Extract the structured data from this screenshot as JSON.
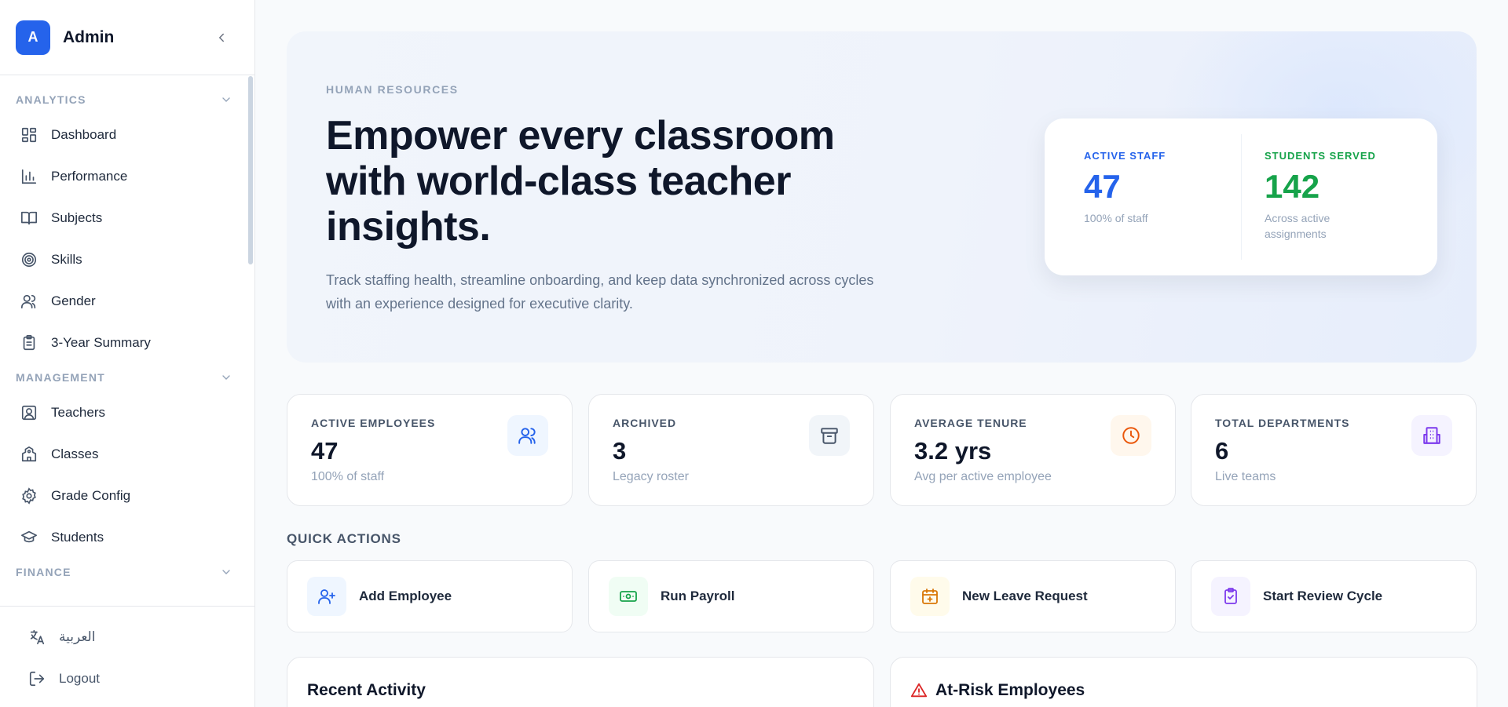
{
  "sidebar": {
    "avatar_letter": "A",
    "brand": "Admin",
    "sections": [
      {
        "label": "ANALYTICS",
        "items": [
          {
            "label": "Dashboard",
            "icon": "dashboard-icon"
          },
          {
            "label": "Performance",
            "icon": "bar-chart-icon"
          },
          {
            "label": "Subjects",
            "icon": "book-icon"
          },
          {
            "label": "Skills",
            "icon": "target-icon"
          },
          {
            "label": "Gender",
            "icon": "users-icon"
          },
          {
            "label": "3-Year Summary",
            "icon": "clipboard-icon"
          }
        ]
      },
      {
        "label": "MANAGEMENT",
        "items": [
          {
            "label": "Teachers",
            "icon": "contact-icon"
          },
          {
            "label": "Classes",
            "icon": "school-icon"
          },
          {
            "label": "Grade Config",
            "icon": "gear-icon"
          },
          {
            "label": "Students",
            "icon": "graduation-cap-icon"
          }
        ]
      },
      {
        "label": "FINANCE",
        "items": []
      }
    ],
    "footer": {
      "language": "العربية",
      "logout": "Logout"
    }
  },
  "hero": {
    "eyebrow": "HUMAN RESOURCES",
    "title": "Empower every classroom with world-class teacher insights.",
    "description": "Track staffing health, streamline onboarding, and keep data synchronized across cycles with an experience designed for executive clarity.",
    "card": {
      "active_staff_label": "ACTIVE STAFF",
      "active_staff_value": "47",
      "active_staff_sub": "100% of staff",
      "students_label": "STUDENTS SERVED",
      "students_value": "142",
      "students_sub": "Across active assignments"
    }
  },
  "stats": [
    {
      "label": "ACTIVE EMPLOYEES",
      "value": "47",
      "sub": "100% of staff",
      "icon": "users-icon",
      "color": "#2563eb",
      "bg": "#eff6ff"
    },
    {
      "label": "ARCHIVED",
      "value": "3",
      "sub": "Legacy roster",
      "icon": "archive-icon",
      "color": "#475569",
      "bg": "#f1f5f9"
    },
    {
      "label": "AVERAGE TENURE",
      "value": "3.2 yrs",
      "sub": "Avg per active employee",
      "icon": "clock-icon",
      "color": "#ea580c",
      "bg": "#fff7ed"
    },
    {
      "label": "TOTAL DEPARTMENTS",
      "value": "6",
      "sub": "Live teams",
      "icon": "building-icon",
      "color": "#7c3aed",
      "bg": "#f5f3ff"
    }
  ],
  "quick_actions": {
    "title": "QUICK ACTIONS",
    "items": [
      {
        "label": "Add Employee",
        "icon": "user-plus-icon",
        "color": "#2563eb",
        "bg": "#eff6ff"
      },
      {
        "label": "Run Payroll",
        "icon": "banknote-icon",
        "color": "#16a34a",
        "bg": "#f0fdf4"
      },
      {
        "label": "New Leave Request",
        "icon": "calendar-plus-icon",
        "color": "#d97706",
        "bg": "#fffbeb"
      },
      {
        "label": "Start Review Cycle",
        "icon": "clipboard-check-icon",
        "color": "#7c3aed",
        "bg": "#f5f3ff"
      }
    ]
  },
  "panels": {
    "recent_activity": "Recent Activity",
    "at_risk": "At-Risk Employees"
  },
  "colors": {
    "accent": "#2563eb",
    "green": "#16a34a",
    "danger": "#dc2626"
  }
}
